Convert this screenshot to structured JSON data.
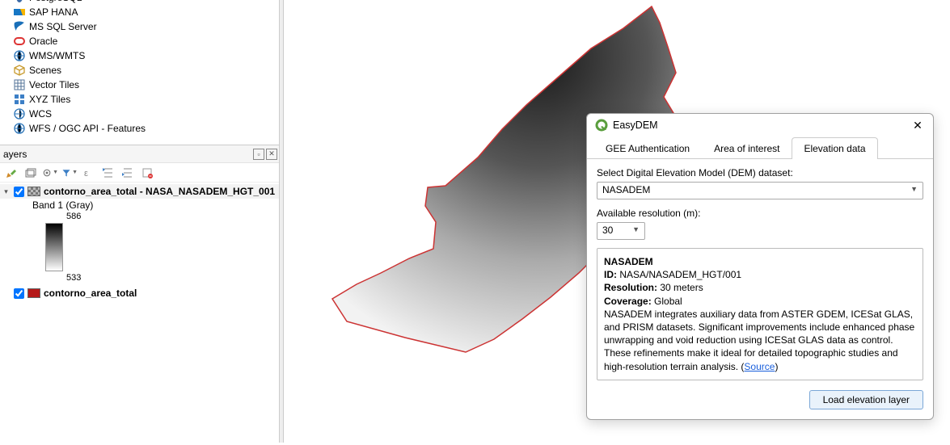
{
  "browser_items": [
    {
      "icon": "postgres",
      "label": "PostgreSQL"
    },
    {
      "icon": "saphana",
      "label": "SAP HANA"
    },
    {
      "icon": "mssql",
      "label": "MS SQL Server"
    },
    {
      "icon": "oracle",
      "label": "Oracle"
    },
    {
      "icon": "wms",
      "label": "WMS/WMTS"
    },
    {
      "icon": "scenes",
      "label": "Scenes"
    },
    {
      "icon": "vector",
      "label": "Vector Tiles"
    },
    {
      "icon": "xyz",
      "label": "XYZ Tiles"
    },
    {
      "icon": "wcs",
      "label": "WCS"
    },
    {
      "icon": "wfs",
      "label": "WFS / OGC API - Features"
    }
  ],
  "layers_panel": {
    "title": "ayers",
    "layers": [
      {
        "name": "contorno_area_total - NASA_NASADEM_HGT_001",
        "band": "Band 1 (Gray)",
        "ramp_max": "586",
        "ramp_min": "533",
        "type": "dem",
        "checked": true
      },
      {
        "name": "contorno_area_total",
        "type": "poly",
        "checked": true
      }
    ]
  },
  "dialog": {
    "title": "EasyDEM",
    "tabs": [
      "GEE Authentication",
      "Area of interest",
      "Elevation data"
    ],
    "active_tab": 2,
    "label_select_dem": "Select Digital Elevation Model (DEM) dataset:",
    "dem_value": "NASADEM",
    "label_resolution": "Available resolution (m):",
    "resolution_value": "30",
    "desc": {
      "name": "NASADEM",
      "id_label": "ID:",
      "id_value": "NASA/NASADEM_HGT/001",
      "res_label": "Resolution:",
      "res_value": "30 meters",
      "cov_label": "Coverage:",
      "cov_value": "Global",
      "text": "NASADEM integrates auxiliary data from ASTER GDEM, ICESat GLAS, and PRISM datasets. Significant improvements include enhanced phase unwrapping and void reduction using ICESat GLAS data as control. These refinements make it ideal for detailed topographic studies and high-resolution terrain analysis. (",
      "source_label": "Source",
      "text_end": ")"
    },
    "button": "Load elevation layer"
  }
}
